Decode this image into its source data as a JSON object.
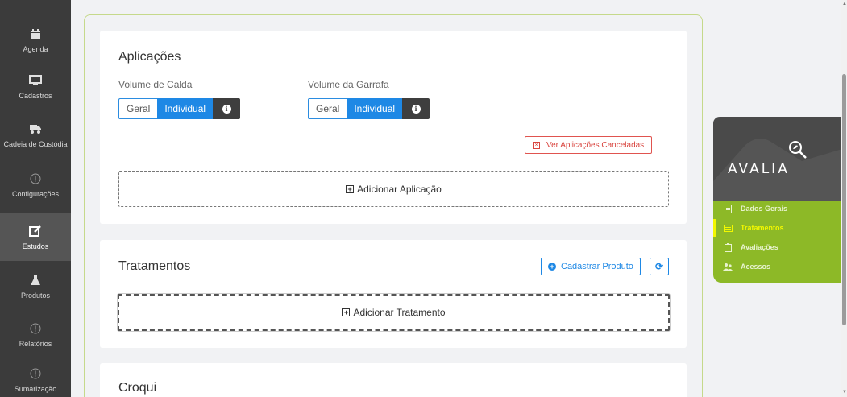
{
  "sidebar": {
    "items": [
      {
        "label": "Agenda",
        "icon": "calendar-icon"
      },
      {
        "label": "Cadastros",
        "icon": "monitor-icon"
      },
      {
        "label": "Cadeia de Custódia",
        "icon": "truck-icon"
      },
      {
        "label": "Configurações",
        "icon": "alert-circle-icon"
      },
      {
        "label": "Estudos",
        "icon": "edit-icon"
      },
      {
        "label": "Produtos",
        "icon": "flask-icon"
      },
      {
        "label": "Relatórios",
        "icon": "alert-circle-icon"
      },
      {
        "label": "Sumarização",
        "icon": "alert-circle-icon"
      }
    ],
    "active_index": 4
  },
  "aplicacoes": {
    "title": "Aplicações",
    "volume_calda": {
      "label": "Volume de Calda",
      "geral": "Geral",
      "individual": "Individual"
    },
    "volume_garrafa": {
      "label": "Volume da Garrafa",
      "geral": "Geral",
      "individual": "Individual"
    },
    "ver_canceladas": "Ver Aplicações Canceladas",
    "adicionar": "Adicionar Aplicação"
  },
  "tratamentos": {
    "title": "Tratamentos",
    "cadastrar_produto": "Cadastrar Produto",
    "adicionar": "Adicionar Tratamento"
  },
  "croqui": {
    "title": "Croqui"
  },
  "right_panel": {
    "logo": "AVALIA",
    "menu": [
      {
        "label": "Dados Gerais",
        "icon": "document-icon"
      },
      {
        "label": "Tratamentos",
        "icon": "list-icon"
      },
      {
        "label": "Avaliações",
        "icon": "clipboard-icon"
      },
      {
        "label": "Acessos",
        "icon": "users-icon"
      }
    ],
    "active_index": 1
  },
  "colors": {
    "sidebar_bg": "#3b3b3b",
    "primary_blue": "#1e88e5",
    "danger_red": "#d9453f",
    "brand_green": "#8db927",
    "active_yellow": "#f2f800"
  }
}
